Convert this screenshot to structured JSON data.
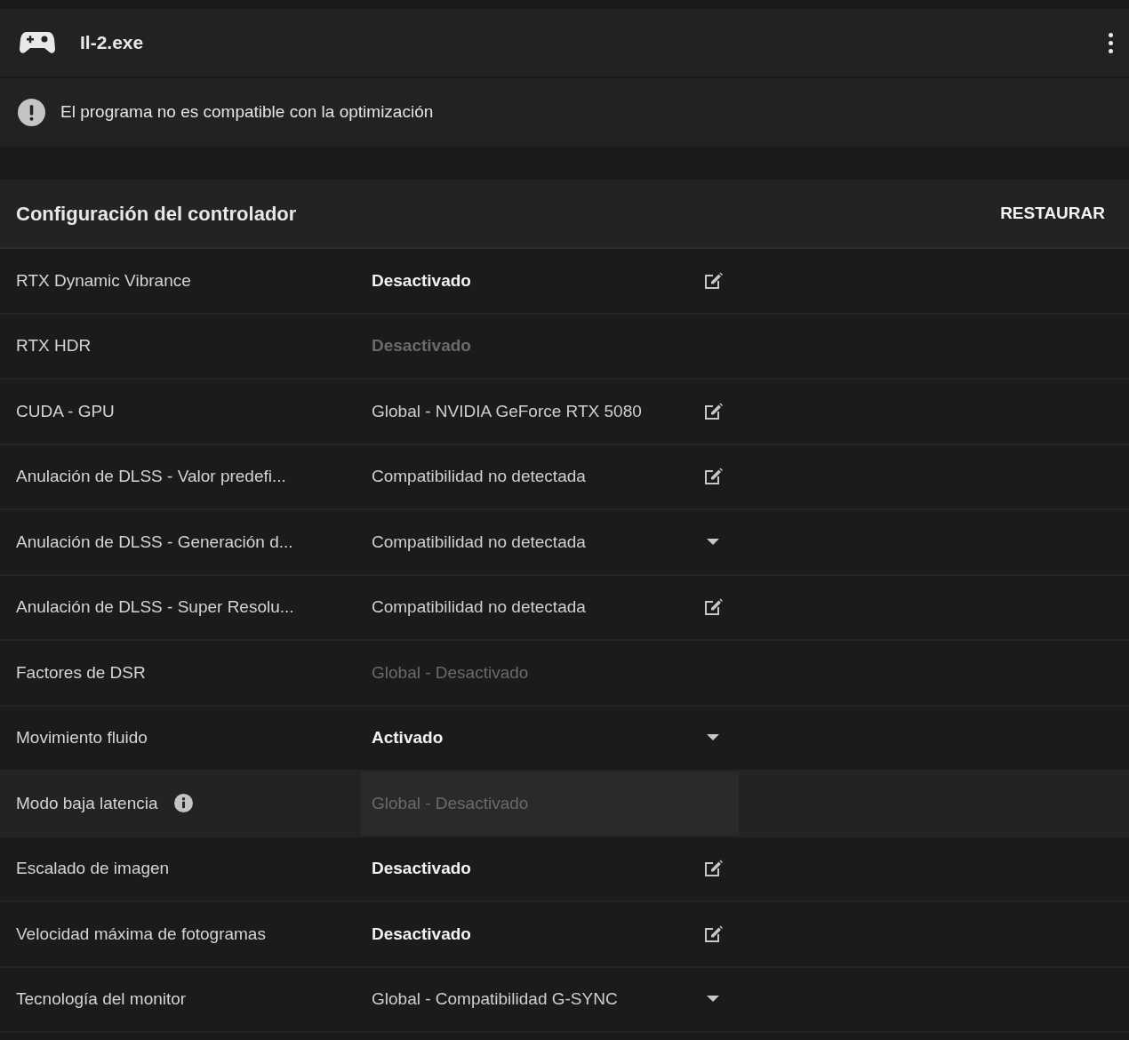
{
  "app": {
    "title": "Il-2.exe"
  },
  "notice": {
    "text": "El programa no es compatible con la optimización"
  },
  "section": {
    "title": "Configuración del controlador",
    "action": "RESTAURAR"
  },
  "rows": [
    {
      "label": "RTX Dynamic Vibrance",
      "value": "Desactivado",
      "modified": true,
      "disabled": false,
      "kind": "edit",
      "info": false,
      "highlighted": false
    },
    {
      "label": "RTX HDR",
      "value": "Desactivado",
      "modified": true,
      "disabled": true,
      "kind": "readonly",
      "info": false,
      "highlighted": false
    },
    {
      "label": "CUDA - GPU",
      "value": "Global - NVIDIA GeForce RTX 5080",
      "modified": false,
      "disabled": false,
      "kind": "edit",
      "info": false,
      "highlighted": false
    },
    {
      "label": "Anulación de DLSS - Valor predefi...",
      "value": "Compatibilidad no detectada",
      "modified": false,
      "disabled": false,
      "kind": "edit",
      "info": false,
      "highlighted": false
    },
    {
      "label": "Anulación de DLSS - Generación d...",
      "value": "Compatibilidad no detectada",
      "modified": false,
      "disabled": false,
      "kind": "dropdown",
      "info": false,
      "highlighted": false
    },
    {
      "label": "Anulación de DLSS - Super Resolu...",
      "value": "Compatibilidad no detectada",
      "modified": false,
      "disabled": false,
      "kind": "edit",
      "info": false,
      "highlighted": false
    },
    {
      "label": "Factores de DSR",
      "value": "Global - Desactivado",
      "modified": false,
      "disabled": true,
      "kind": "readonly",
      "info": false,
      "highlighted": false
    },
    {
      "label": "Movimiento fluido",
      "value": "Activado",
      "modified": true,
      "disabled": false,
      "kind": "dropdown",
      "info": false,
      "highlighted": false
    },
    {
      "label": "Modo baja latencia",
      "value": "Global - Desactivado",
      "modified": false,
      "disabled": true,
      "kind": "readonly",
      "info": true,
      "highlighted": true
    },
    {
      "label": "Escalado de imagen",
      "value": "Desactivado",
      "modified": true,
      "disabled": false,
      "kind": "edit",
      "info": false,
      "highlighted": false
    },
    {
      "label": "Velocidad máxima de fotogramas",
      "value": "Desactivado",
      "modified": true,
      "disabled": false,
      "kind": "edit",
      "info": false,
      "highlighted": false
    },
    {
      "label": "Tecnología del monitor",
      "value": "Global - Compatibilidad G-SYNC",
      "modified": false,
      "disabled": false,
      "kind": "dropdown",
      "info": false,
      "highlighted": false
    }
  ]
}
